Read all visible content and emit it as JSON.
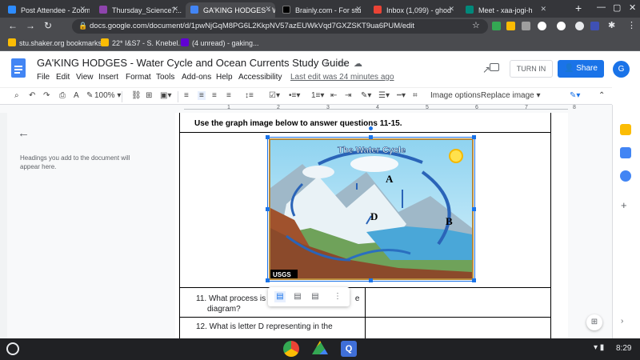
{
  "tabs": [
    {
      "title": "Post Attendee - Zoom",
      "color": "#2d8cff"
    },
    {
      "title": "Thursday_Science7...",
      "color": "#8e44ad"
    },
    {
      "title": "GA'KING HODGES - W",
      "color": "#4285f4"
    },
    {
      "title": "Brainly.com - For stu",
      "color": "#000000"
    },
    {
      "title": "Inbox (1,099) - ghod",
      "color": "#ea4335"
    },
    {
      "title": "Meet - xaa-jogi-h",
      "color": "#00897b"
    }
  ],
  "browser": {
    "url": "docs.google.com/document/d/1pwNjGqM8PG6L2KkpNV57azEUWkVqd7GXZSKT9ua6PUM/edit",
    "bookmarks": [
      {
        "label": "stu.shaker.org bookmarks",
        "color": "#fbbc04"
      },
      {
        "label": "22* I&S7 - S. Knebel...",
        "color": "#fbbc04"
      },
      {
        "label": "(4 unread) - gaking...",
        "color": "#6001d2"
      }
    ]
  },
  "doc": {
    "title": "GA'KING HODGES - Water Cycle and Ocean Currents Study Guide",
    "menus": [
      "File",
      "Edit",
      "View",
      "Insert",
      "Format",
      "Tools",
      "Add-ons",
      "Help",
      "Accessibility"
    ],
    "last_edit": "Last edit was 24 minutes ago",
    "turn_in": "TURN IN",
    "share": "Share",
    "avatar_letter": "G"
  },
  "toolbar": {
    "zoom": "100%",
    "image_options": "Image options",
    "replace_image": "Replace image"
  },
  "ruler_numbers": [
    "1",
    "2",
    "3",
    "4",
    "5",
    "6",
    "7",
    "8"
  ],
  "outline": {
    "hint": "Headings you add to the document will appear here."
  },
  "content": {
    "heading": "Use the graph image below to answer questions 11-15.",
    "image": {
      "title": "The Water Cycle",
      "labels": [
        "A",
        "B",
        "D"
      ],
      "credit": "USGS"
    },
    "q11_a": "11. What process is s",
    "q11_b": "e",
    "q11_c": "diagram?",
    "q12": "12. What is letter D representing in the"
  },
  "taskbar": {
    "time": "8:29"
  }
}
